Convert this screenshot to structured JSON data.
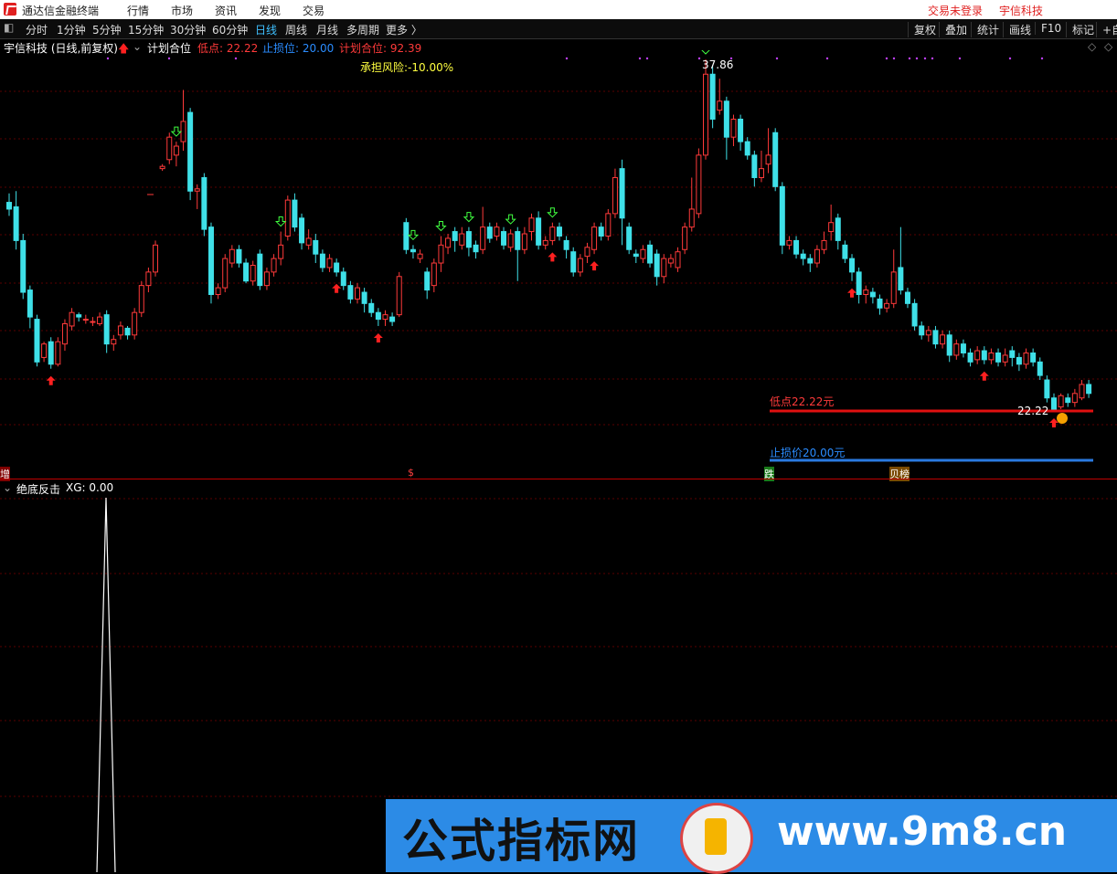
{
  "titlebar": {
    "app_title": "通达信金融终端",
    "menu": [
      "行情",
      "市场",
      "资讯",
      "发现",
      "交易"
    ],
    "login_status": "交易未登录",
    "stock_name": "宇信科技"
  },
  "toolbar": {
    "periods": [
      "分时",
      "1分钟",
      "5分钟",
      "15分钟",
      "30分钟",
      "60分钟",
      "日线",
      "周线",
      "月线",
      "多周期",
      "更多 〉"
    ],
    "active_period": "日线",
    "right_buttons": [
      "复权",
      "叠加",
      "统计",
      "画线",
      "F10",
      "标记",
      "+自"
    ]
  },
  "main_panel": {
    "stock_label": "宇信科技 (日线,前复权)",
    "indicator_name": "计划合位",
    "low_point_label": "低点: 22.22",
    "stop_loss_label": "止损位: 20.00",
    "plan_label": "计划合位: 92.39",
    "risk_label": "承担风险:-10.00%",
    "high_value": "37.86",
    "low_value": "22.22",
    "low_line_label": "低点22.22元",
    "stop_line_label": "止损价20.00元",
    "event_marks": [
      "增",
      "$",
      "跌",
      "贝榜"
    ]
  },
  "sub_panel": {
    "indicator_label": "绝底反击",
    "xg_label": "XG: 0.00"
  },
  "colors": {
    "up": "#ff3a3a",
    "down": "#3fe0e8",
    "background": "#000000",
    "separator": "#c00000",
    "low_line": "#e01010",
    "stop_line": "#2a7ae0",
    "buy_arrow": "#ff2020",
    "sell_arrow": "#40ff40"
  },
  "watermark": {
    "text_cn": "公式指标网",
    "text_url": "www.9m8.cn"
  },
  "chart_data": {
    "type": "candlestick",
    "price_high": 37.86,
    "price_low": 22.22,
    "stop_loss": 20.0,
    "bars": [
      [
        0,
        31.5,
        31.2,
        30.9,
        31.9
      ],
      [
        1,
        31.3,
        29.8,
        29.4,
        32.0
      ],
      [
        2,
        29.8,
        27.5,
        27.2,
        30.1
      ],
      [
        3,
        27.6,
        26.4,
        25.9,
        27.8
      ],
      [
        4,
        26.3,
        24.4,
        24.2,
        26.5
      ],
      [
        5,
        24.6,
        25.2,
        24.4,
        25.3
      ],
      [
        6,
        25.3,
        24.3,
        24.1,
        25.5
      ],
      [
        7,
        24.3,
        25.3,
        24.2,
        25.5
      ],
      [
        8,
        25.2,
        26.1,
        24.9,
        26.3
      ],
      [
        9,
        26.0,
        26.6,
        25.8,
        26.8
      ],
      [
        10,
        26.5,
        26.4,
        26.2,
        26.6
      ],
      [
        11,
        26.3,
        26.3,
        26.1,
        26.5
      ],
      [
        12,
        26.2,
        26.2,
        26.0,
        26.4
      ],
      [
        13,
        26.1,
        26.4,
        26.0,
        26.6
      ],
      [
        14,
        26.5,
        25.2,
        24.8,
        26.7
      ],
      [
        15,
        25.2,
        25.4,
        24.9,
        25.6
      ],
      [
        16,
        25.6,
        26.0,
        25.4,
        26.2
      ],
      [
        17,
        25.9,
        25.6,
        25.4,
        26.0
      ],
      [
        18,
        25.6,
        26.6,
        25.4,
        26.8
      ],
      [
        19,
        26.6,
        27.8,
        26.4,
        28.0
      ],
      [
        20,
        27.8,
        28.4,
        27.5,
        28.6
      ],
      [
        21,
        28.4,
        29.6,
        28.2,
        29.8
      ],
      [
        22,
        33.0,
        33.1,
        32.9,
        33.2
      ],
      [
        23,
        33.4,
        34.4,
        33.2,
        34.6
      ],
      [
        24,
        33.6,
        34.0,
        33.1,
        34.2
      ],
      [
        25,
        34.2,
        35.1,
        33.8,
        36.5
      ],
      [
        26,
        35.5,
        32.0,
        31.6,
        35.7
      ],
      [
        27,
        32.0,
        32.1,
        31.2,
        32.3
      ],
      [
        28,
        32.6,
        30.3,
        30.0,
        32.8
      ],
      [
        29,
        30.4,
        27.4,
        27.0,
        30.6
      ],
      [
        30,
        27.4,
        27.7,
        27.2,
        27.9
      ],
      [
        31,
        27.7,
        29.0,
        27.5,
        29.2
      ],
      [
        32,
        28.8,
        29.4,
        28.6,
        29.6
      ],
      [
        33,
        29.4,
        28.8,
        28.6,
        29.6
      ],
      [
        34,
        28.8,
        28.0,
        27.9,
        29.0
      ],
      [
        35,
        28.0,
        28.7,
        27.8,
        28.9
      ],
      [
        36,
        29.2,
        27.8,
        27.6,
        29.4
      ],
      [
        37,
        27.8,
        28.4,
        27.6,
        28.6
      ],
      [
        38,
        28.4,
        29.0,
        28.2,
        29.2
      ],
      [
        39,
        29.0,
        29.6,
        28.7,
        30.2
      ],
      [
        40,
        30.0,
        31.6,
        29.8,
        31.8
      ],
      [
        41,
        31.6,
        30.4,
        30.2,
        31.9
      ],
      [
        42,
        30.8,
        29.7,
        29.4,
        31.0
      ],
      [
        43,
        29.6,
        29.9,
        29.4,
        30.3
      ],
      [
        44,
        29.8,
        29.2,
        28.8,
        30.1
      ],
      [
        45,
        29.2,
        28.6,
        28.4,
        29.4
      ],
      [
        46,
        28.6,
        29.0,
        28.4,
        29.2
      ],
      [
        47,
        28.8,
        28.4,
        28.2,
        29.0
      ],
      [
        48,
        28.4,
        27.8,
        27.6,
        28.6
      ],
      [
        49,
        27.8,
        27.2,
        27.0,
        28.0
      ],
      [
        50,
        27.2,
        27.7,
        27.0,
        27.9
      ],
      [
        51,
        27.5,
        27.0,
        26.6,
        27.7
      ],
      [
        52,
        27.0,
        26.6,
        26.4,
        27.2
      ],
      [
        53,
        26.6,
        26.3,
        26.0,
        26.8
      ],
      [
        54,
        26.3,
        26.5,
        26.0,
        26.7
      ],
      [
        55,
        26.4,
        26.2,
        26.0,
        26.6
      ],
      [
        56,
        26.5,
        28.2,
        26.4,
        28.4
      ],
      [
        57,
        30.6,
        29.4,
        29.2,
        30.8
      ],
      [
        58,
        29.4,
        29.3,
        29.0,
        29.6
      ],
      [
        59,
        29.0,
        29.2,
        28.8,
        29.4
      ],
      [
        60,
        28.4,
        27.6,
        27.2,
        28.6
      ],
      [
        61,
        27.8,
        28.8,
        27.5,
        29.0
      ],
      [
        62,
        28.8,
        29.6,
        28.4,
        30.0
      ],
      [
        63,
        29.5,
        29.9,
        29.2,
        30.1
      ],
      [
        64,
        30.2,
        29.8,
        29.3,
        30.4
      ],
      [
        65,
        29.6,
        30.1,
        29.4,
        30.4
      ],
      [
        66,
        30.2,
        29.5,
        29.1,
        30.4
      ],
      [
        67,
        29.6,
        29.3,
        29.0,
        29.8
      ],
      [
        68,
        29.4,
        30.4,
        29.2,
        31.3
      ],
      [
        69,
        30.4,
        29.9,
        29.7,
        30.6
      ],
      [
        70,
        30.0,
        30.4,
        29.8,
        30.6
      ],
      [
        71,
        30.2,
        29.6,
        29.4,
        30.4
      ],
      [
        72,
        29.5,
        30.1,
        29.3,
        30.3
      ],
      [
        73,
        30.2,
        29.4,
        28.0,
        30.4
      ],
      [
        74,
        29.4,
        30.1,
        29.2,
        30.4
      ],
      [
        75,
        30.2,
        30.8,
        29.8,
        31.0
      ],
      [
        76,
        30.8,
        29.6,
        29.4,
        31.1
      ],
      [
        77,
        29.6,
        29.8,
        29.4,
        30.0
      ],
      [
        78,
        29.8,
        30.4,
        29.6,
        30.6
      ],
      [
        79,
        30.4,
        30.0,
        29.8,
        30.6
      ],
      [
        80,
        29.8,
        29.4,
        29.0,
        30.0
      ],
      [
        81,
        29.3,
        28.4,
        28.2,
        29.5
      ],
      [
        82,
        28.4,
        29.0,
        28.2,
        29.2
      ],
      [
        83,
        29.1,
        29.5,
        28.8,
        29.7
      ],
      [
        84,
        29.4,
        30.4,
        29.2,
        30.6
      ],
      [
        85,
        30.4,
        30.0,
        29.8,
        30.6
      ],
      [
        86,
        30.0,
        31.0,
        29.8,
        31.2
      ],
      [
        87,
        31.0,
        32.6,
        30.8,
        33.0
      ],
      [
        88,
        33.0,
        30.8,
        29.6,
        33.4
      ],
      [
        89,
        30.4,
        29.4,
        29.2,
        30.6
      ],
      [
        90,
        29.2,
        29.1,
        28.8,
        29.4
      ],
      [
        91,
        29.0,
        29.4,
        28.8,
        29.6
      ],
      [
        92,
        29.6,
        28.8,
        28.6,
        29.8
      ],
      [
        93,
        29.2,
        28.2,
        27.8,
        29.4
      ],
      [
        94,
        28.2,
        29.0,
        27.9,
        29.2
      ],
      [
        95,
        28.8,
        29.0,
        28.6,
        29.2
      ],
      [
        96,
        28.6,
        29.3,
        28.4,
        29.5
      ],
      [
        97,
        29.4,
        30.4,
        29.2,
        30.6
      ],
      [
        98,
        30.4,
        31.2,
        30.2,
        32.6
      ],
      [
        99,
        31.0,
        33.6,
        30.8,
        33.9
      ],
      [
        100,
        33.6,
        37.2,
        33.4,
        37.86
      ],
      [
        101,
        37.2,
        35.2,
        34.8,
        37.6
      ],
      [
        102,
        35.6,
        36.0,
        35.4,
        37.0
      ],
      [
        103,
        36.0,
        34.4,
        33.4,
        36.2
      ],
      [
        104,
        34.4,
        35.2,
        34.0,
        35.4
      ],
      [
        105,
        35.2,
        34.2,
        33.8,
        35.4
      ],
      [
        106,
        34.2,
        33.6,
        33.4,
        34.4
      ],
      [
        107,
        33.6,
        32.6,
        32.2,
        33.8
      ],
      [
        108,
        32.6,
        33.0,
        32.4,
        33.8
      ],
      [
        109,
        33.2,
        33.6,
        32.8,
        34.8
      ],
      [
        110,
        34.6,
        32.2,
        32.0,
        34.8
      ],
      [
        111,
        32.2,
        29.6,
        29.2,
        32.4
      ],
      [
        112,
        29.6,
        29.8,
        29.4,
        30.0
      ],
      [
        113,
        29.8,
        29.2,
        29.0,
        30.0
      ],
      [
        114,
        29.2,
        29.0,
        28.7,
        29.4
      ],
      [
        115,
        29.0,
        28.8,
        28.4,
        29.2
      ],
      [
        116,
        28.8,
        29.4,
        28.6,
        29.6
      ],
      [
        117,
        29.4,
        29.8,
        29.2,
        30.2
      ],
      [
        118,
        30.2,
        30.6,
        29.8,
        31.4
      ],
      [
        119,
        30.8,
        29.8,
        29.4,
        31.0
      ],
      [
        120,
        29.6,
        29.0,
        28.8,
        29.8
      ],
      [
        121,
        29.0,
        28.4,
        28.0,
        29.2
      ],
      [
        122,
        28.4,
        27.4,
        27.0,
        28.6
      ],
      [
        123,
        27.4,
        27.6,
        27.0,
        27.8
      ],
      [
        124,
        27.5,
        27.3,
        27.0,
        27.7
      ],
      [
        125,
        27.2,
        26.8,
        26.5,
        27.4
      ],
      [
        126,
        26.8,
        27.0,
        26.6,
        27.2
      ],
      [
        127,
        27.0,
        28.4,
        26.8,
        29.4
      ],
      [
        128,
        28.6,
        27.6,
        27.4,
        30.4
      ],
      [
        129,
        27.5,
        27.0,
        26.8,
        27.7
      ],
      [
        130,
        27.0,
        26.0,
        25.8,
        27.2
      ],
      [
        131,
        26.0,
        25.6,
        25.4,
        26.2
      ],
      [
        132,
        25.6,
        25.8,
        25.3,
        26.0
      ],
      [
        133,
        25.8,
        25.2,
        25.0,
        26.0
      ],
      [
        134,
        25.2,
        25.6,
        25.0,
        25.8
      ],
      [
        135,
        25.6,
        24.7,
        24.4,
        25.8
      ],
      [
        136,
        24.7,
        25.2,
        24.5,
        25.4
      ],
      [
        137,
        25.2,
        24.8,
        24.6,
        25.4
      ],
      [
        138,
        24.8,
        24.4,
        24.2,
        25.0
      ],
      [
        139,
        24.5,
        24.9,
        24.3,
        25.1
      ],
      [
        140,
        24.9,
        24.5,
        24.3,
        25.1
      ],
      [
        141,
        24.5,
        24.8,
        24.3,
        25.0
      ],
      [
        142,
        24.8,
        24.4,
        24.2,
        25.0
      ],
      [
        143,
        24.4,
        24.7,
        24.2,
        25.0
      ],
      [
        144,
        24.9,
        24.6,
        24.2,
        25.1
      ],
      [
        145,
        24.6,
        24.3,
        24.0,
        24.8
      ],
      [
        146,
        24.3,
        24.8,
        24.1,
        25.0
      ],
      [
        147,
        24.8,
        24.4,
        24.2,
        25.0
      ],
      [
        148,
        24.4,
        23.8,
        23.6,
        24.6
      ],
      [
        149,
        23.6,
        22.8,
        22.6,
        23.8
      ],
      [
        150,
        22.8,
        22.3,
        22.22,
        23.0
      ],
      [
        151,
        22.4,
        22.9,
        22.3,
        23.0
      ],
      [
        152,
        22.8,
        22.6,
        22.4,
        23.0
      ],
      [
        153,
        22.6,
        23.0,
        22.4,
        23.2
      ],
      [
        154,
        22.8,
        23.4,
        22.7,
        23.6
      ],
      [
        155,
        23.4,
        23.0,
        22.8,
        23.6
      ]
    ],
    "buy_signals": [
      6,
      47,
      53,
      78,
      84,
      121,
      140,
      150
    ],
    "sell_signals": [
      24,
      39,
      58,
      62,
      66,
      72,
      78,
      100
    ]
  }
}
